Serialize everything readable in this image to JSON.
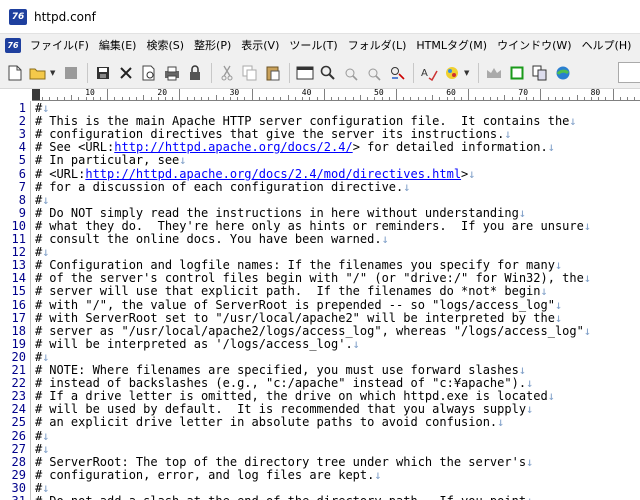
{
  "window": {
    "title": "httpd.conf",
    "app_icon_text": "76"
  },
  "menubar": {
    "items": [
      "ファイル(F)",
      "編集(E)",
      "検索(S)",
      "整形(P)",
      "表示(V)",
      "ツール(T)",
      "フォルダ(L)",
      "HTMLタグ(M)",
      "ウインドウ(W)",
      "ヘルプ(H)"
    ]
  },
  "toolbar": {
    "icons": [
      "new-file-icon",
      "open-folder-icon",
      "dropdown-arrow-icon",
      "save-disabled-icon",
      "save-all-icon",
      "close-icon",
      "print-preview-icon",
      "print-icon",
      "lock-icon",
      "cut-icon",
      "copy-icon",
      "paste-icon",
      "window-icon",
      "search-icon",
      "find-next-icon",
      "find-prev-icon",
      "replace-icon",
      "spell-check-icon",
      "color-icon",
      "dropdown-arrow-icon",
      "crown-icon",
      "green-box-icon",
      "compare-icon",
      "browser-icon"
    ]
  },
  "ruler": {
    "labels": [
      "10",
      "20",
      "30",
      "40",
      "50",
      "60",
      "70",
      "80"
    ]
  },
  "editor": {
    "eol_marker": "↓",
    "lines": [
      {
        "n": "1",
        "text": "",
        "link": "",
        "after": ""
      },
      {
        "n": "2",
        "text": "This is the main Apache HTTP server configuration file.  It contains the",
        "link": "",
        "after": ""
      },
      {
        "n": "3",
        "text": "configuration directives that give the server its instructions.",
        "link": "",
        "after": ""
      },
      {
        "n": "4",
        "text": "See <URL:",
        "link": "http://httpd.apache.org/docs/2.4/",
        "after": "> for detailed information."
      },
      {
        "n": "5",
        "text": "In particular, see",
        "link": "",
        "after": ""
      },
      {
        "n": "6",
        "text": "<URL:",
        "link": "http://httpd.apache.org/docs/2.4/mod/directives.html",
        "after": ">"
      },
      {
        "n": "7",
        "text": "for a discussion of each configuration directive.",
        "link": "",
        "after": ""
      },
      {
        "n": "8",
        "text": "",
        "link": "",
        "after": ""
      },
      {
        "n": "9",
        "text": "Do NOT simply read the instructions in here without understanding",
        "link": "",
        "after": ""
      },
      {
        "n": "10",
        "text": "what they do.  They're here only as hints or reminders.  If you are unsure",
        "link": "",
        "after": ""
      },
      {
        "n": "11",
        "text": "consult the online docs. You have been warned.",
        "link": "",
        "after": ""
      },
      {
        "n": "12",
        "text": "",
        "link": "",
        "after": ""
      },
      {
        "n": "13",
        "text": "Configuration and logfile names: If the filenames you specify for many",
        "link": "",
        "after": ""
      },
      {
        "n": "14",
        "text": "of the server's control files begin with \"/\" (or \"drive:/\" for Win32), the",
        "link": "",
        "after": ""
      },
      {
        "n": "15",
        "text": "server will use that explicit path.  If the filenames do *not* begin",
        "link": "",
        "after": ""
      },
      {
        "n": "16",
        "text": "with \"/\", the value of ServerRoot is prepended -- so \"logs/access_log\"",
        "link": "",
        "after": ""
      },
      {
        "n": "17",
        "text": "with ServerRoot set to \"/usr/local/apache2\" will be interpreted by the",
        "link": "",
        "after": ""
      },
      {
        "n": "18",
        "text": "server as \"/usr/local/apache2/logs/access_log\", whereas \"/logs/access_log\"",
        "link": "",
        "after": ""
      },
      {
        "n": "19",
        "text": "will be interpreted as '/logs/access_log'.",
        "link": "",
        "after": ""
      },
      {
        "n": "20",
        "text": "",
        "link": "",
        "after": ""
      },
      {
        "n": "21",
        "text": "NOTE: Where filenames are specified, you must use forward slashes",
        "link": "",
        "after": ""
      },
      {
        "n": "22",
        "text": "instead of backslashes (e.g., \"c:/apache\" instead of \"c:¥apache\").",
        "link": "",
        "after": ""
      },
      {
        "n": "23",
        "text": "If a drive letter is omitted, the drive on which httpd.exe is located",
        "link": "",
        "after": ""
      },
      {
        "n": "24",
        "text": "will be used by default.  It is recommended that you always supply",
        "link": "",
        "after": ""
      },
      {
        "n": "25",
        "text": "an explicit drive letter in absolute paths to avoid confusion.",
        "link": "",
        "after": ""
      },
      {
        "n": "26",
        "text": "",
        "link": "",
        "after": ""
      },
      {
        "n": "27",
        "text": "",
        "link": "",
        "after": ""
      },
      {
        "n": "28",
        "text": "ServerRoot: The top of the directory tree under which the server's",
        "link": "",
        "after": ""
      },
      {
        "n": "29",
        "text": "configuration, error, and log files are kept.",
        "link": "",
        "after": ""
      },
      {
        "n": "30",
        "text": "",
        "link": "",
        "after": ""
      },
      {
        "n": "31",
        "text": "Do not add a slash at the end of the directory path.  If you point",
        "link": "",
        "after": ""
      }
    ]
  }
}
